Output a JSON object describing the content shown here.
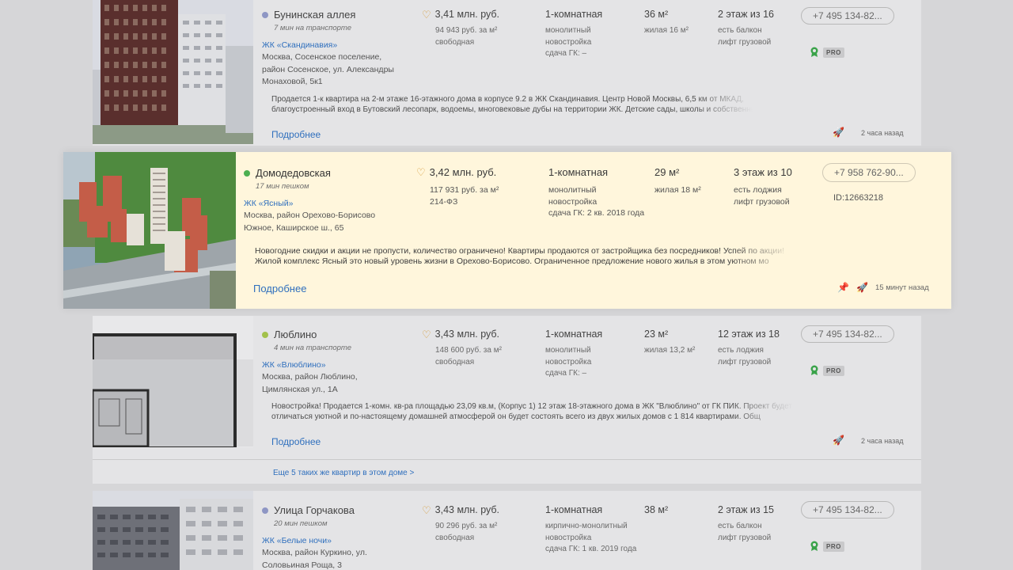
{
  "listings": [
    {
      "metro": "Бунинская аллея",
      "metro_color": "#8e96c4",
      "transport": "7 мин на транспорте",
      "complex": "ЖК «Скандинавия»",
      "address": "Москва, Сосенское поселение, район Сосенское, ул. Александры Монаховой, 5к1",
      "price": "3,41 млн. руб.",
      "price_per_m": "94 943 руб. за м²",
      "sale_type": "свободная",
      "rooms": "1-комнатная",
      "build_type": "монолитный",
      "category": "новостройка",
      "delivery": "сдача ГК: –",
      "area": "36 м²",
      "living_area": "жилая 16 м²",
      "floor": "2 этаж из 16",
      "balcony": "есть балкон",
      "elevator": "лифт грузовой",
      "phone": "+7 495 134-82...",
      "pro": "PRO",
      "description": [
        "Продается 1-к квартира на 2-м этаже 16-этажного дома в корпусе 9.2 в ЖК Скандинавия. Центр Новой Москвы, 6,5 км от МКАД,",
        "благоустроенный вход в Бутовский лесопарк, водоемы, многовековые дубы на территории ЖК. Детские сады, школы и собственный"
      ],
      "more": "Подробнее",
      "time": "2 часа назад"
    },
    {
      "metro": "Домодедовская",
      "metro_color": "#4caf50",
      "transport": "17 мин пешком",
      "complex": "ЖК «Ясный»",
      "address": "Москва, район Орехово-Борисово Южное, Каширское ш., 65",
      "price": "3,42 млн. руб.",
      "price_per_m": "117 931 руб. за м²",
      "sale_type": "214-ФЗ",
      "rooms": "1-комнатная",
      "build_type": "монолитный",
      "category": "новостройка",
      "delivery": "сдача ГК: 2 кв. 2018 года",
      "area": "29 м²",
      "living_area": "жилая 18 м²",
      "floor": "3 этаж из 10",
      "balcony": "есть лоджия",
      "elevator": "лифт грузовой",
      "phone": "+7 958 762-90...",
      "listing_id": "ID:12663218",
      "description": [
        "Новогодние скидки и акции не пропусти, количество ограничено! Квартиры продаются от застройщика без посредников! Успей по акции!",
        "Жилой комплекс Ясный это новый уровень жизни в Орехово-Борисово. Ограниченное предложение нового жилья в этом уютном мо"
      ],
      "more": "Подробнее",
      "time": "15 минут назад"
    },
    {
      "metro": "Люблино",
      "metro_color": "#a2c14b",
      "transport": "4 мин на транспорте",
      "complex": "ЖК «Влюблино»",
      "address": "Москва, район Люблино, Цимлянская ул., 1А",
      "price": "3,43 млн. руб.",
      "price_per_m": "148 600 руб. за м²",
      "sale_type": "свободная",
      "rooms": "1-комнатная",
      "build_type": "монолитный",
      "category": "новостройка",
      "delivery": "сдача ГК: –",
      "area": "23 м²",
      "living_area": "жилая 13,2 м²",
      "floor": "12 этаж из 18",
      "balcony": "есть лоджия",
      "elevator": "лифт грузовой",
      "phone": "+7 495 134-82...",
      "pro": "PRO",
      "description": [
        "Новостройка! Продается 1-комн. кв-ра площадью 23,09 кв.м, (Корпус 1) 12 этаж 18-этажного дома в ЖК \"Влюблино\" от ГК ПИК. Проект будет",
        "отличаться уютной и по-настоящему домашней атмосферой он будет состоять всего из двух жилых домов с 1 814 квартирами. Общ"
      ],
      "more": "Подробнее",
      "time": "2 часа назад",
      "same_house": "Еще 5 таких же квартир в этом доме >"
    },
    {
      "metro": "Улица Горчакова",
      "metro_color": "#8e96c4",
      "transport": "20 мин пешком",
      "complex": "ЖК «Белые ночи»",
      "address": "Москва, район Куркино, ул. Соловьиная Роща, 3",
      "price": "3,43 млн. руб.",
      "price_per_m": "90 296 руб. за м²",
      "sale_type": "свободная",
      "rooms": "1-комнатная",
      "build_type": "кирпично-монолитный",
      "category": "новостройка",
      "delivery": "сдача ГК: 1 кв. 2019 года",
      "area": "38 м²",
      "floor": "2 этаж из 15",
      "balcony": "есть балкон",
      "elevator": "лифт грузовой",
      "phone": "+7 495 134-82...",
      "pro": "PRO"
    }
  ]
}
